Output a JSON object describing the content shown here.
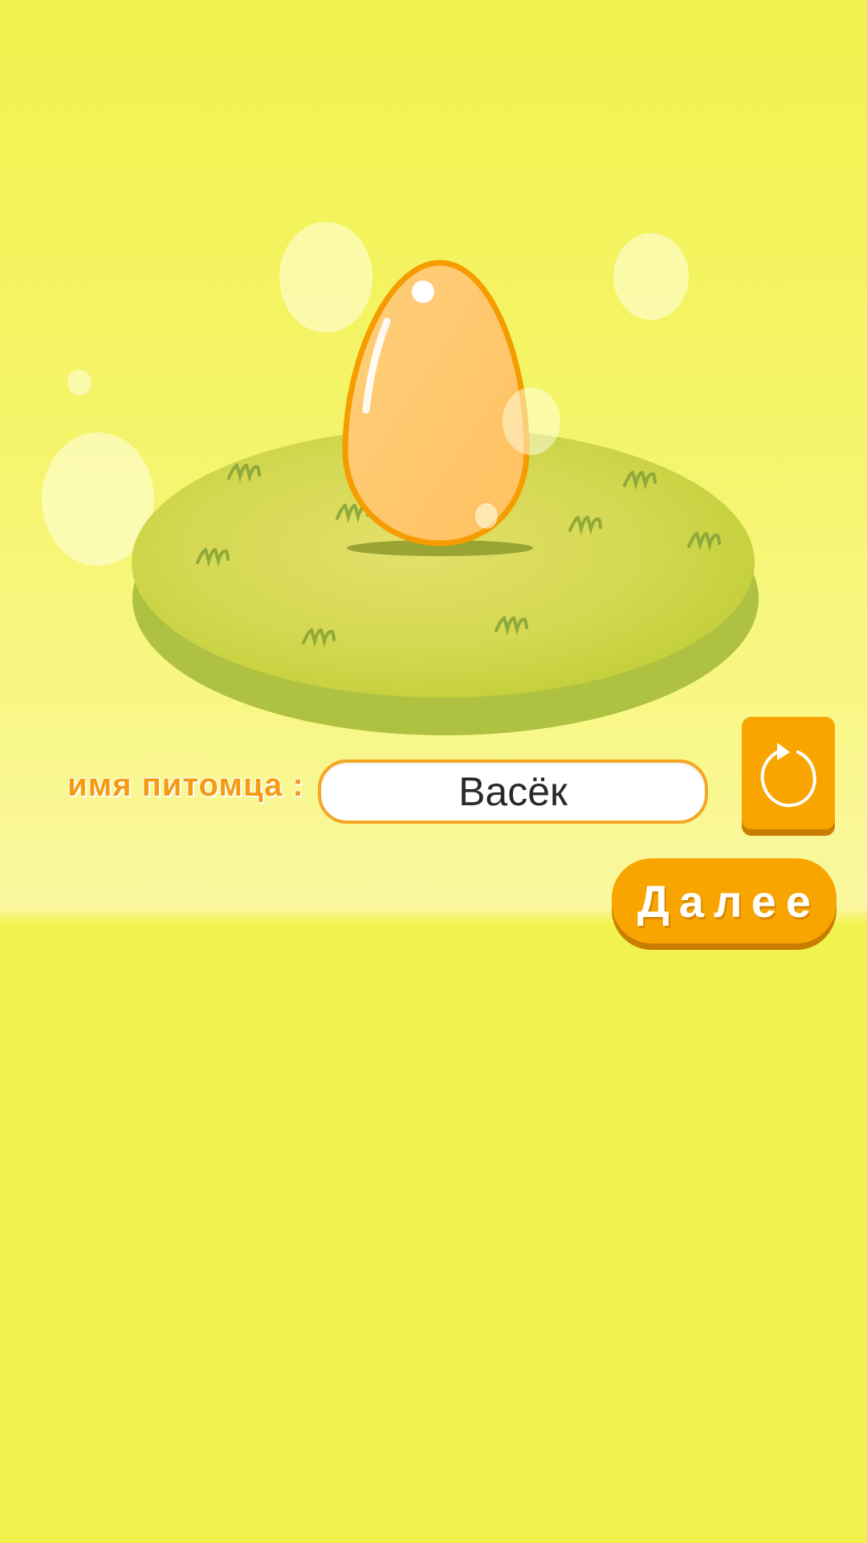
{
  "pet_name": {
    "label": "имя питомца :",
    "value": "Васёк"
  },
  "buttons": {
    "reroll_icon": "refresh-icon",
    "next_label": "Далее"
  },
  "scene": {
    "egg_icon": "egg-icon",
    "island_icon": "grass-island-icon"
  },
  "colors": {
    "background": "#f2f24e",
    "accent": "#f9a500",
    "egg": "#ffc56a",
    "grass": "#cdd94a"
  }
}
